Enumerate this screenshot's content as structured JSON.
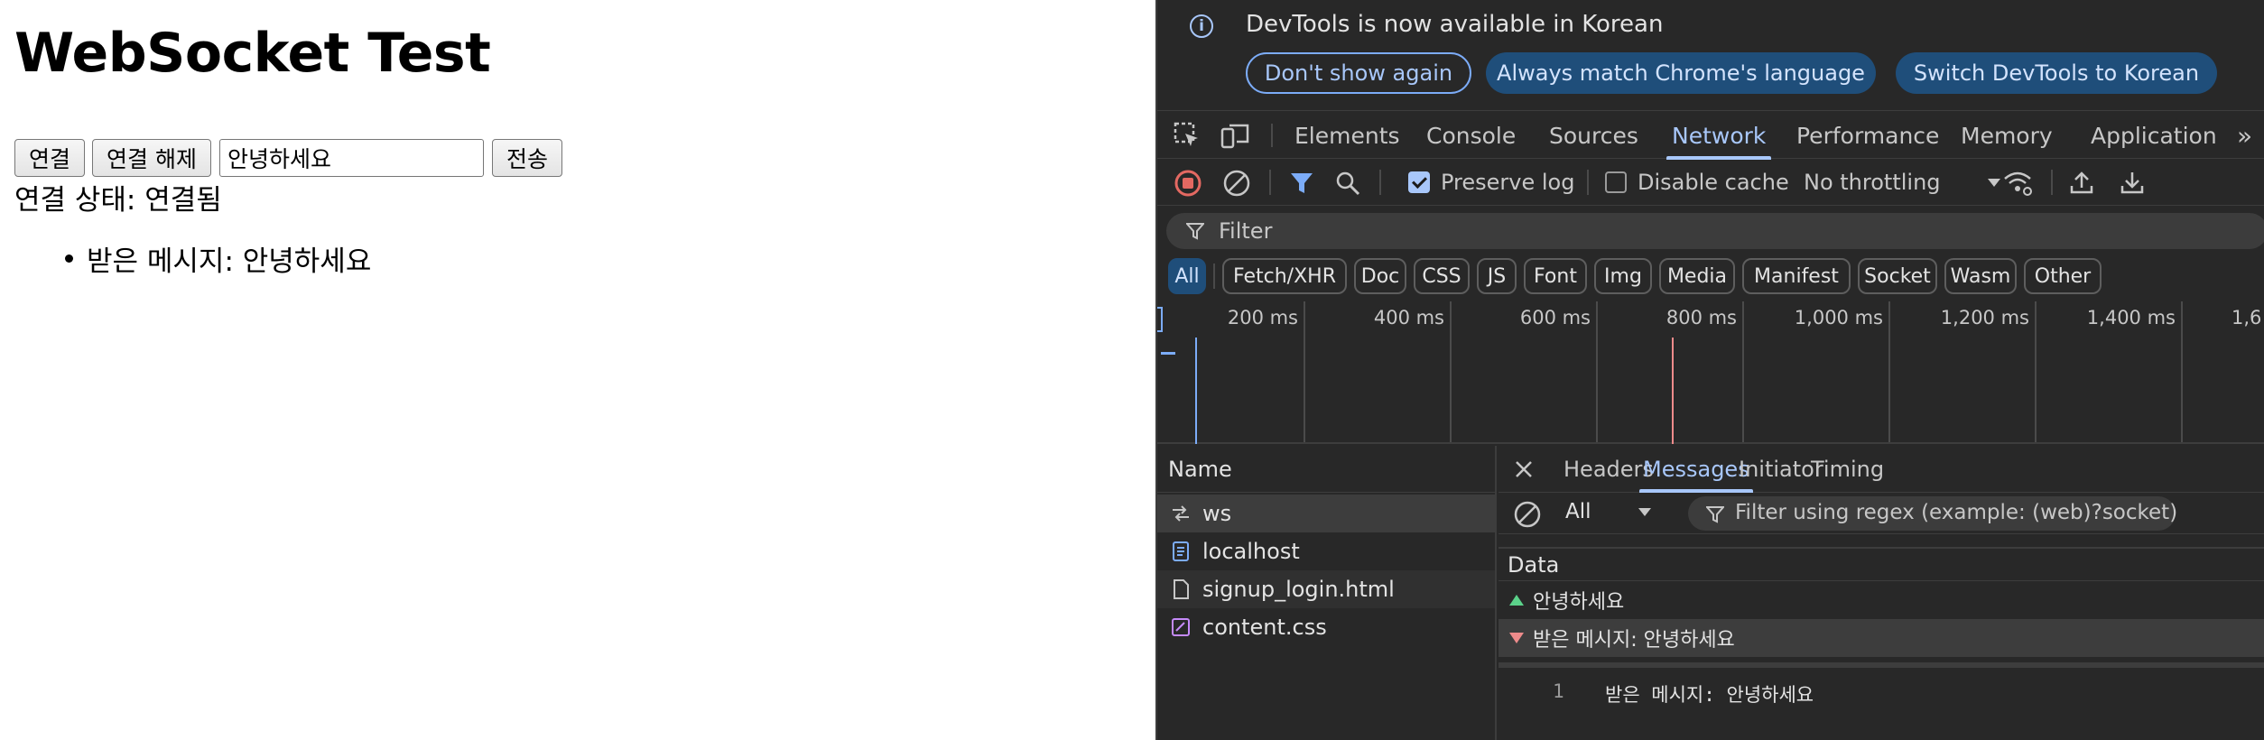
{
  "page": {
    "title": "WebSocket Test",
    "connect_label": "연결",
    "disconnect_label": "연결 해제",
    "input_value": "안녕하세요",
    "send_label": "전송",
    "status_text": "연결 상태: 연결됨",
    "messages": [
      "받은 메시지: 안녕하세요"
    ]
  },
  "devtools": {
    "info": {
      "text": "DevTools is now available in Korean",
      "btn_dont_show": "Don't show again",
      "btn_match": "Always match Chrome's language",
      "btn_switch": "Switch DevTools to Korean"
    },
    "tabs": [
      "Elements",
      "Console",
      "Sources",
      "Network",
      "Performance",
      "Memory",
      "Application"
    ],
    "active_tab": "Network",
    "more_tabs_icon": "»",
    "toolbar": {
      "preserve_log": "Preserve log",
      "preserve_log_checked": true,
      "disable_cache": "Disable cache",
      "disable_cache_checked": false,
      "throttling": "No throttling"
    },
    "filter_placeholder": "Filter",
    "type_filters": [
      "All",
      "Fetch/XHR",
      "Doc",
      "CSS",
      "JS",
      "Font",
      "Img",
      "Media",
      "Manifest",
      "Socket",
      "Wasm",
      "Other"
    ],
    "active_type_filter": "All",
    "timeline_labels": [
      "200 ms",
      "400 ms",
      "600 ms",
      "800 ms",
      "1,000 ms",
      "1,200 ms",
      "1,400 ms",
      "1,6"
    ],
    "name_header": "Name",
    "requests": [
      {
        "name": "ws",
        "icon": "websocket-icon"
      },
      {
        "name": "localhost",
        "icon": "document-icon"
      },
      {
        "name": "signup_login.html",
        "icon": "file-icon"
      },
      {
        "name": "content.css",
        "icon": "stylesheet-icon"
      }
    ],
    "detail_tabs": [
      "Headers",
      "Messages",
      "Initiator",
      "Timing"
    ],
    "active_detail_tab": "Messages",
    "message_filter_select": "All",
    "regex_placeholder": "Filter using regex (example: (web)?socket)",
    "data_header": "Data",
    "frames": [
      {
        "direction": "sent",
        "data": "안녕하세요"
      },
      {
        "direction": "received",
        "data": "받은 메시지: 안녕하세요"
      }
    ],
    "preview_line_number": "1",
    "preview_text": "받은 메시지: 안녕하세요",
    "colors": {
      "accent": "#a8c7fa",
      "panel_bg": "#282828",
      "sent_arrow": "#5bd28a",
      "received_arrow": "#ee8b8b"
    }
  }
}
